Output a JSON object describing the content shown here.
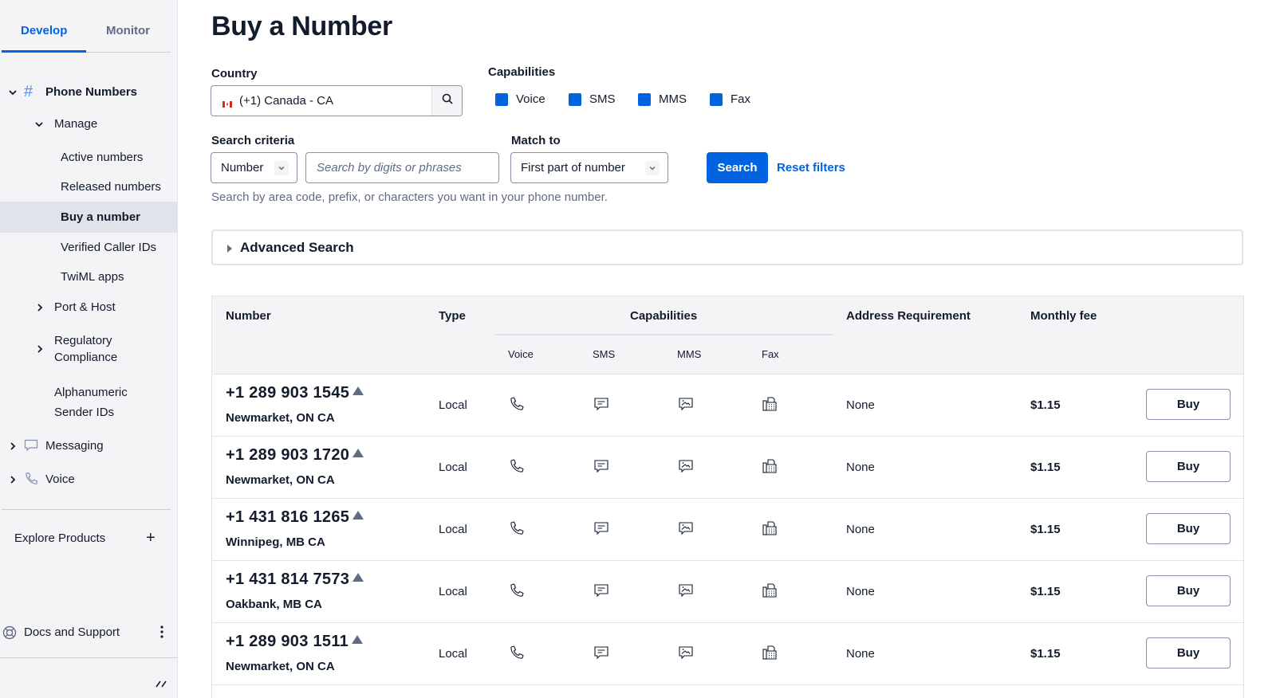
{
  "sidebar": {
    "tabs": [
      {
        "label": "Develop",
        "active": true
      },
      {
        "label": "Monitor",
        "active": false
      }
    ],
    "phone_numbers": {
      "label": "Phone Numbers",
      "expanded": true
    },
    "manage": {
      "label": "Manage",
      "expanded": true
    },
    "manage_items": [
      {
        "label": "Active numbers"
      },
      {
        "label": "Released numbers"
      },
      {
        "label": "Buy a number",
        "selected": true
      },
      {
        "label": "Verified Caller IDs"
      },
      {
        "label": "TwiML apps"
      }
    ],
    "port_host": {
      "label": "Port & Host"
    },
    "regulatory": {
      "line1": "Regulatory",
      "line2": "Compliance"
    },
    "alphanumeric": {
      "line1": "Alphanumeric",
      "line2": "Sender IDs"
    },
    "messaging": {
      "label": "Messaging"
    },
    "voice": {
      "label": "Voice"
    },
    "explore": {
      "label": "Explore Products"
    },
    "docs": {
      "label": "Docs and Support"
    }
  },
  "main": {
    "title": "Buy a Number",
    "country": {
      "label": "Country",
      "value": "(+1) Canada - CA"
    },
    "capabilities": {
      "label": "Capabilities",
      "options": [
        {
          "label": "Voice",
          "checked": true
        },
        {
          "label": "SMS",
          "checked": true
        },
        {
          "label": "MMS",
          "checked": true
        },
        {
          "label": "Fax",
          "checked": true
        }
      ]
    },
    "search_criteria": {
      "label": "Search criteria",
      "type_value": "Number",
      "placeholder": "Search by digits or phrases"
    },
    "match_to": {
      "label": "Match to",
      "value": "First part of number"
    },
    "search_label": "Search",
    "reset_label": "Reset filters",
    "help_text": "Search by area code, prefix, or characters you want in your phone number.",
    "advanced_search": "Advanced Search",
    "accent_color": "#0263e0"
  },
  "table": {
    "headers": {
      "number": "Number",
      "type": "Type",
      "capabilities": "Capabilities",
      "address": "Address Requirement",
      "fee": "Monthly fee"
    },
    "cap_headers": [
      "Voice",
      "SMS",
      "MMS",
      "Fax"
    ],
    "rows": [
      {
        "number": "+1 289 903 1545",
        "location": "Newmarket, ON CA",
        "type": "Local",
        "address": "None",
        "fee": "$1.15",
        "action": "Buy"
      },
      {
        "number": "+1 289 903 1720",
        "location": "Newmarket, ON CA",
        "type": "Local",
        "address": "None",
        "fee": "$1.15",
        "action": "Buy"
      },
      {
        "number": "+1 431 816 1265",
        "location": "Winnipeg, MB CA",
        "type": "Local",
        "address": "None",
        "fee": "$1.15",
        "action": "Buy"
      },
      {
        "number": "+1 431 814 7573",
        "location": "Oakbank, MB CA",
        "type": "Local",
        "address": "None",
        "fee": "$1.15",
        "action": "Buy"
      },
      {
        "number": "+1 289 903 1511",
        "location": "Newmarket, ON CA",
        "type": "Local",
        "address": "None",
        "fee": "$1.15",
        "action": "Buy"
      }
    ]
  }
}
